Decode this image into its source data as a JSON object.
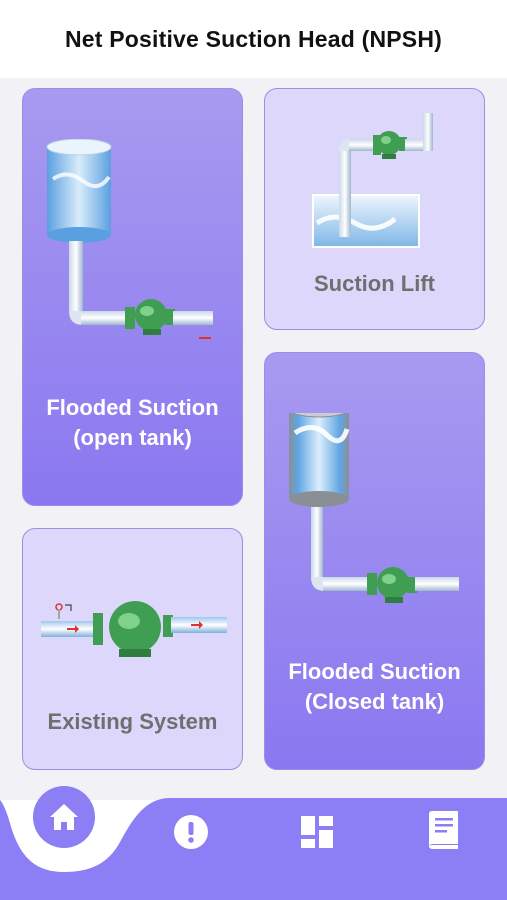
{
  "header": {
    "title": "Net Positive Suction Head (NPSH)"
  },
  "cards": {
    "flooded_open": {
      "label_line1": "Flooded Suction",
      "label_line2": "(open tank)"
    },
    "suction_lift": {
      "label": "Suction Lift"
    },
    "existing_system": {
      "label": "Existing System"
    },
    "flooded_closed": {
      "label_line1": "Flooded Suction",
      "label_line2": "(Closed tank)"
    }
  },
  "nav": {
    "items": [
      {
        "icon": "home-icon",
        "active": true
      },
      {
        "icon": "alert-icon",
        "active": false
      },
      {
        "icon": "dashboard-icon",
        "active": false
      },
      {
        "icon": "book-icon",
        "active": false
      }
    ]
  },
  "colors": {
    "accent": "#8c7ef4",
    "card_dark": "#9685f0",
    "card_light": "#dcd7fb",
    "pump_green": "#3f9e52",
    "flow_arrow": "#e03030"
  }
}
